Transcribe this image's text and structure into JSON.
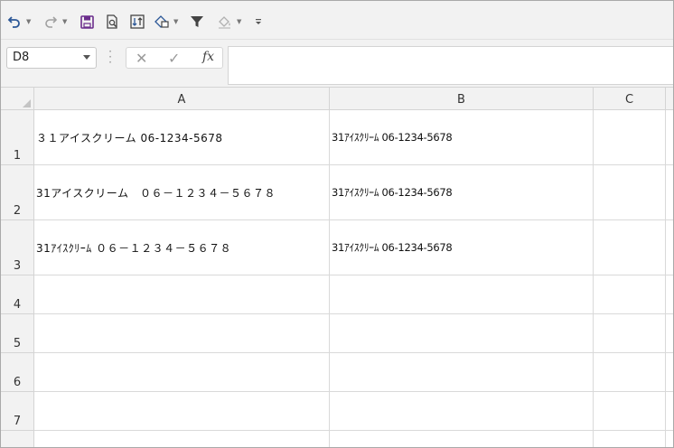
{
  "toolbar": {
    "icons": [
      {
        "name": "undo-icon",
        "color": "#2b5797"
      },
      {
        "name": "redo-icon",
        "color": "#9a9a9a"
      },
      {
        "name": "save-icon",
        "color": "#6b2d8c"
      },
      {
        "name": "print-preview-icon",
        "color": "#444444"
      },
      {
        "name": "sort-icon",
        "color": "#444444"
      },
      {
        "name": "shapes-icon",
        "color": "#2b5797"
      },
      {
        "name": "filter-icon",
        "color": "#444444"
      },
      {
        "name": "fill-color-icon",
        "color": "#9a9a9a"
      },
      {
        "name": "customize-toolbar-icon",
        "color": "#444444"
      }
    ]
  },
  "formula_bar": {
    "name_box": "D8",
    "formula": "",
    "fx_label": "fx"
  },
  "sheet": {
    "columns": [
      "A",
      "B",
      "C"
    ],
    "rows": [
      {
        "header": "1",
        "a": "３１アイスクリーム 06-1234-5678",
        "b": "31ｱｲｽｸﾘｰﾑ 06-1234-5678",
        "c": ""
      },
      {
        "header": "2",
        "a": "31アイスクリーム　０６－１２３４－５６７８",
        "b": "31ｱｲｽｸﾘｰﾑ 06-1234-5678",
        "c": ""
      },
      {
        "header": "3",
        "a": "31ｱｲｽｸﾘｰﾑ ０６－１２３４－５６７８",
        "b": "31ｱｲｽｸﾘｰﾑ 06-1234-5678",
        "c": ""
      },
      {
        "header": "4",
        "a": "",
        "b": "",
        "c": ""
      },
      {
        "header": "5",
        "a": "",
        "b": "",
        "c": ""
      },
      {
        "header": "6",
        "a": "",
        "b": "",
        "c": ""
      },
      {
        "header": "7",
        "a": "",
        "b": "",
        "c": ""
      }
    ]
  }
}
